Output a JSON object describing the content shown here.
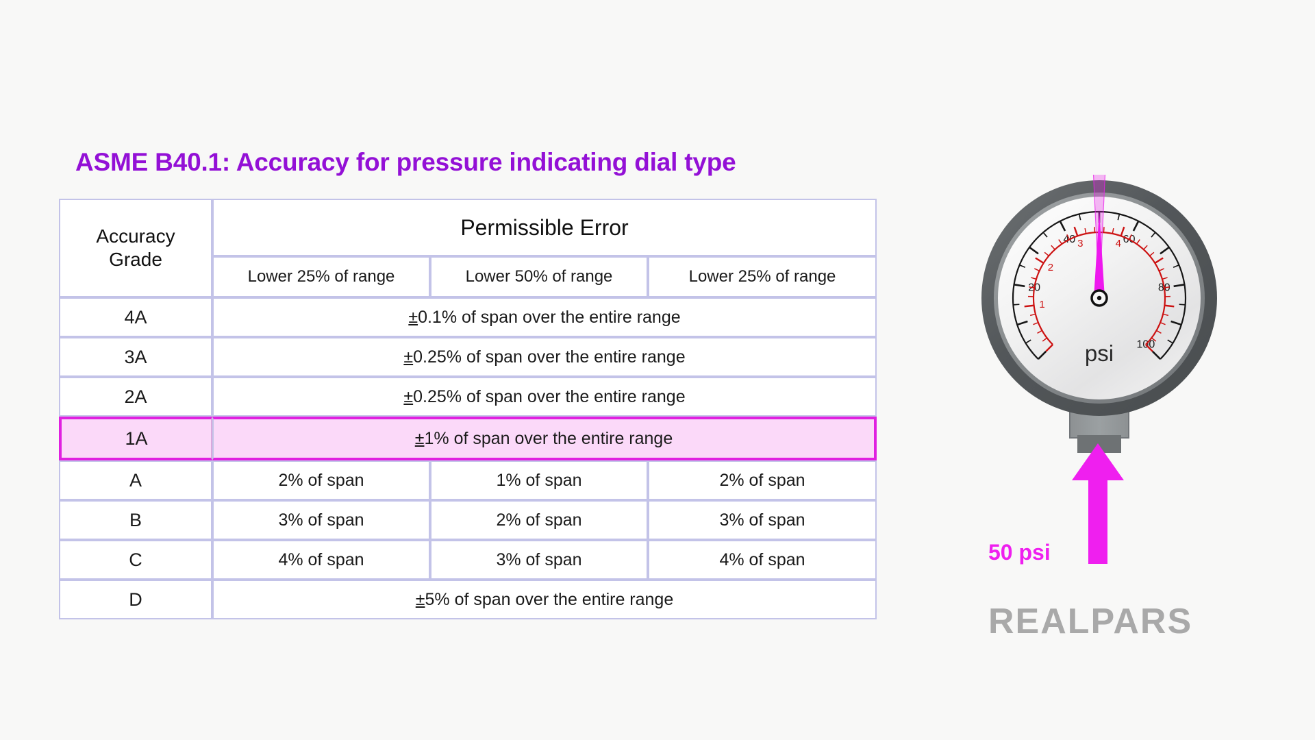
{
  "page": {
    "background": "#f8f8f7",
    "title": "ASME B40.1: Accuracy for pressure indicating dial type",
    "title_color": "#9310d6"
  },
  "table": {
    "grade_header": "Accuracy\nGrade",
    "grade_header_line1": "Accuracy",
    "grade_header_line2": "Grade",
    "permissible_header": "Permissible Error",
    "sub_headers": [
      "Lower 25% of range",
      "Lower 50% of range",
      "Lower 25% of range"
    ],
    "border_color": "#c3c3e8",
    "highlight": {
      "grade": "1A",
      "border_color": "#e020e0",
      "fill_color": "#fbd9f9"
    },
    "rows": [
      {
        "grade": "4A",
        "span_all": true,
        "text": "0.1% of span over the entire range",
        "prefix": "±",
        "cells": []
      },
      {
        "grade": "3A",
        "span_all": true,
        "text": "0.25% of span over the entire range",
        "prefix": "±",
        "cells": []
      },
      {
        "grade": "2A",
        "span_all": true,
        "text": "0.25% of span over the entire range",
        "prefix": "±",
        "cells": []
      },
      {
        "grade": "1A",
        "span_all": true,
        "text": "1% of span over the entire range",
        "prefix": "±",
        "highlighted": true,
        "cells": []
      },
      {
        "grade": "A",
        "span_all": false,
        "text": "",
        "prefix": "",
        "cells": [
          "2% of span",
          "1% of span",
          "2% of span"
        ]
      },
      {
        "grade": "B",
        "span_all": false,
        "text": "",
        "prefix": "",
        "cells": [
          "3% of span",
          "2% of span",
          "3% of span"
        ]
      },
      {
        "grade": "C",
        "span_all": false,
        "text": "",
        "prefix": "",
        "cells": [
          "4% of span",
          "3% of span",
          "4% of span"
        ]
      },
      {
        "grade": "D",
        "span_all": true,
        "text": "5% of span over the entire range",
        "prefix": "±",
        "cells": []
      }
    ]
  },
  "gauge": {
    "unit_label": "psi",
    "band_low": "49",
    "band_high": "51",
    "supply_label": "50 psi",
    "needle_value": "50",
    "needle_color": "#ee18ee",
    "band_color": "#e91fe9",
    "outer_ring_color": "#5b5f61",
    "inner_ring_color": "#8b8f91",
    "face_color": "#f4f4f4",
    "outer_scale": {
      "unit": "psi",
      "min": 0,
      "max": 100,
      "labels": [
        "20",
        "40",
        "60",
        "80",
        "100"
      ],
      "label_values": [
        20,
        40,
        60,
        80,
        100
      ],
      "major_step": 10,
      "minor_step": 5,
      "color": "#161616"
    },
    "inner_scale": {
      "unit": "bar",
      "min": 0,
      "max": 7,
      "labels": [
        "1",
        "2",
        "3",
        "4"
      ],
      "label_values": [
        1,
        2,
        3,
        4
      ],
      "color": "#cc1111"
    }
  },
  "logo": {
    "text": "REALPARS",
    "color": "#a9a9a9"
  }
}
